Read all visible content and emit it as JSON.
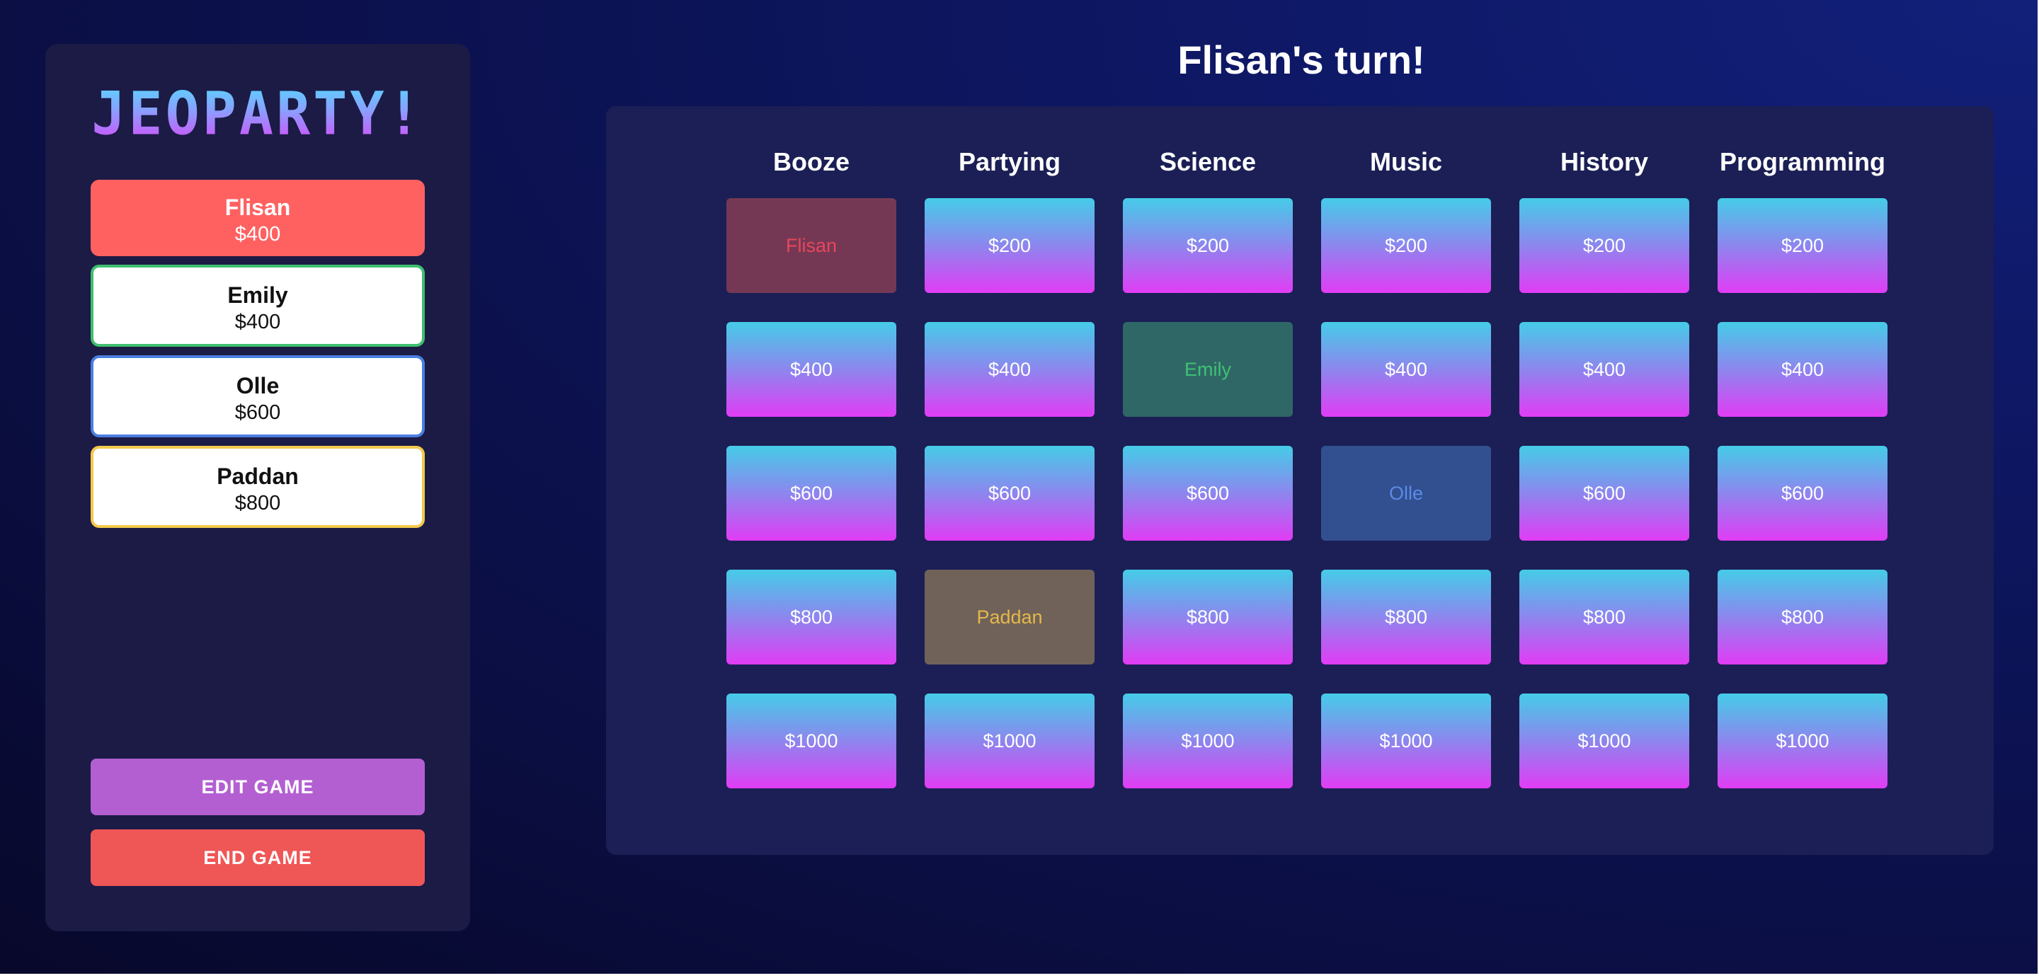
{
  "app": {
    "logo_text": "JEOPARTY!",
    "turn_text": "Flisan's turn!"
  },
  "players": [
    {
      "name": "Flisan",
      "score": "$400",
      "color": "#ff6161",
      "active": true
    },
    {
      "name": "Emily",
      "score": "$400",
      "color": "#3fbf6e",
      "active": false
    },
    {
      "name": "Olle",
      "score": "$600",
      "color": "#4a7ee0",
      "active": false
    },
    {
      "name": "Paddan",
      "score": "$800",
      "color": "#f2c94c",
      "active": false
    }
  ],
  "buttons": {
    "edit": "EDIT GAME",
    "end": "END GAME"
  },
  "board": {
    "categories": [
      {
        "name": "Booze",
        "tiles": [
          "Flisan",
          "$400",
          "$600",
          "$800",
          "$1000"
        ]
      },
      {
        "name": "Partying",
        "tiles": [
          "$200",
          "$400",
          "$600",
          "Paddan",
          "$1000"
        ]
      },
      {
        "name": "Science",
        "tiles": [
          "$200",
          "Emily",
          "$600",
          "$800",
          "$1000"
        ]
      },
      {
        "name": "Music",
        "tiles": [
          "$200",
          "$400",
          "Olle",
          "$800",
          "$1000"
        ]
      },
      {
        "name": "History",
        "tiles": [
          "$200",
          "$400",
          "$600",
          "$800",
          "$1000"
        ]
      },
      {
        "name": "Programming",
        "tiles": [
          "$200",
          "$400",
          "$600",
          "$800",
          "$1000"
        ]
      }
    ],
    "claimed": [
      {
        "category": 0,
        "row": 0,
        "player": "Flisan"
      },
      {
        "category": 2,
        "row": 1,
        "player": "Emily"
      },
      {
        "category": 3,
        "row": 2,
        "player": "Olle"
      },
      {
        "category": 1,
        "row": 3,
        "player": "Paddan"
      }
    ]
  },
  "colors": {
    "tile_top": "#45cce8",
    "tile_bottom": "#e13cf5",
    "edit_button": "#b35fd2",
    "end_button": "#ef5656"
  }
}
